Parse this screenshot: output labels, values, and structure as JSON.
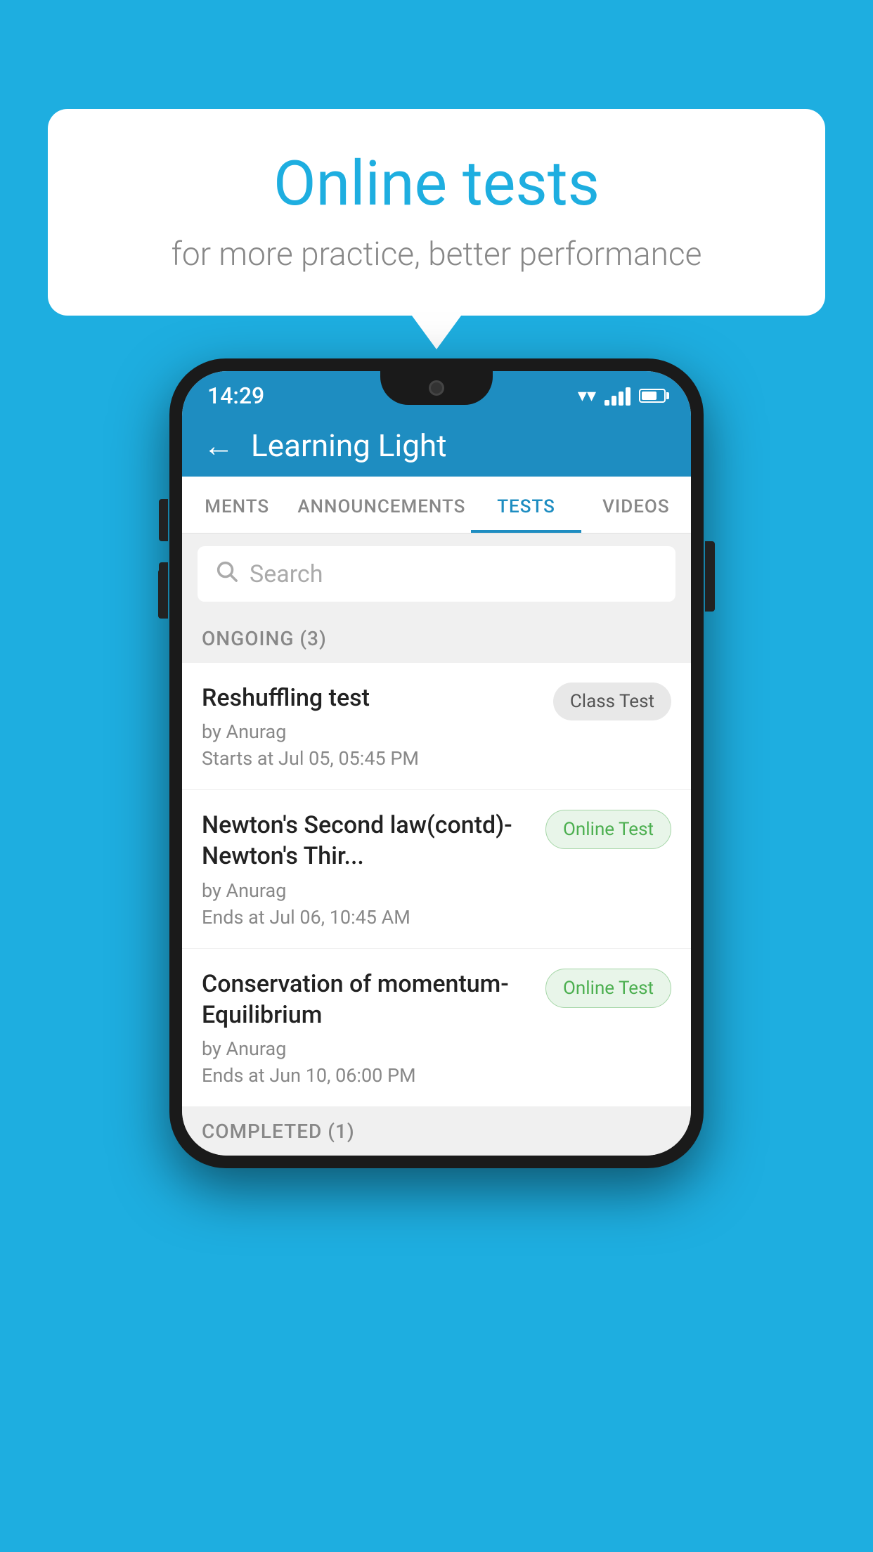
{
  "background_color": "#1EAEE0",
  "speech_bubble": {
    "title": "Online tests",
    "subtitle": "for more practice, better performance"
  },
  "phone": {
    "status_bar": {
      "time": "14:29",
      "icons": [
        "wifi",
        "signal",
        "battery"
      ]
    },
    "app_header": {
      "title": "Learning Light",
      "back_label": "←"
    },
    "tabs": [
      {
        "label": "MENTS",
        "active": false
      },
      {
        "label": "ANNOUNCEMENTS",
        "active": false
      },
      {
        "label": "TESTS",
        "active": true
      },
      {
        "label": "VIDEOS",
        "active": false
      }
    ],
    "search": {
      "placeholder": "Search"
    },
    "ongoing_section": {
      "label": "ONGOING (3)",
      "tests": [
        {
          "title": "Reshuffling test",
          "by": "by Anurag",
          "time": "Starts at  Jul 05, 05:45 PM",
          "badge": "Class Test",
          "badge_type": "class"
        },
        {
          "title": "Newton's Second law(contd)-Newton's Thir...",
          "by": "by Anurag",
          "time": "Ends at  Jul 06, 10:45 AM",
          "badge": "Online Test",
          "badge_type": "online"
        },
        {
          "title": "Conservation of momentum-Equilibrium",
          "by": "by Anurag",
          "time": "Ends at  Jun 10, 06:00 PM",
          "badge": "Online Test",
          "badge_type": "online"
        }
      ]
    },
    "completed_section": {
      "label": "COMPLETED (1)"
    }
  }
}
